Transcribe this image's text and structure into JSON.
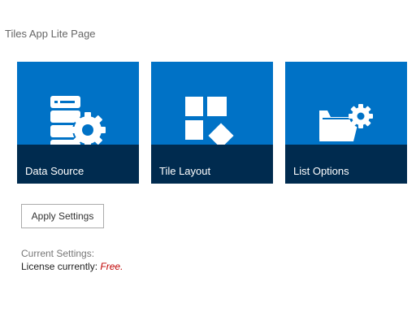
{
  "page": {
    "title": "Tiles App Lite Page"
  },
  "tiles": [
    {
      "label": "Data Source",
      "icon": "database-gear-icon"
    },
    {
      "label": "Tile Layout",
      "icon": "tile-layout-icon"
    },
    {
      "label": "List Options",
      "icon": "folder-gear-icon"
    }
  ],
  "colors": {
    "tile_background": "#0072c6",
    "tile_label_bar": "#002b4f",
    "license_value": "#c00000"
  },
  "actions": {
    "apply_label": "Apply Settings"
  },
  "settings": {
    "heading": "Current Settings:",
    "license_prefix": "License currently:",
    "license_value": "Free."
  }
}
